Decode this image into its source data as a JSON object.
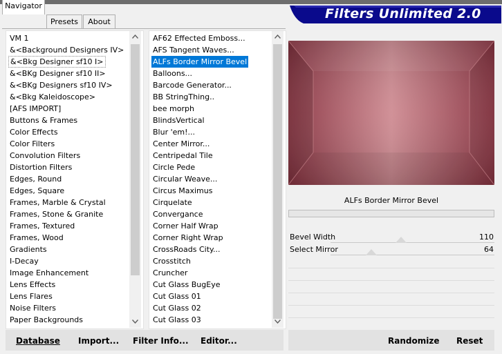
{
  "window": {
    "banner_title": "Filters Unlimited 2.0"
  },
  "tabs": [
    {
      "label": "Navigator",
      "active": true
    },
    {
      "label": "Presets",
      "active": false
    },
    {
      "label": "About",
      "active": false
    }
  ],
  "categories": {
    "items": [
      "VM 1",
      "&<Background Designers IV>",
      "&<Bkg Designer sf10 I>",
      "&<BKg Designer sf10 II>",
      "&<BKg Designers sf10 IV>",
      "&<Bkg Kaleidoscope>",
      "[AFS IMPORT]",
      "Buttons & Frames",
      "Color Effects",
      "Color Filters",
      "Convolution Filters",
      "Distortion Filters",
      "Edges, Round",
      "Edges, Square",
      "Frames, Marble & Crystal",
      "Frames, Stone & Granite",
      "Frames, Textured",
      "Frames, Wood",
      "Gradients",
      "I-Decay",
      "Image Enhancement",
      "Lens Effects",
      "Lens Flares",
      "Noise Filters",
      "Paper Backgrounds"
    ],
    "current": "&<Bkg Designer sf10 I>"
  },
  "filters": {
    "items": [
      "AF62 Effected Emboss...",
      "AFS Tangent Waves...",
      "ALFs Border Mirror Bevel",
      "Balloons...",
      "Barcode Generator...",
      "BB StringThing..",
      "bee morph",
      "BlindsVertical",
      "Blur 'em!...",
      "Center Mirror...",
      "Centripedal Tile",
      "Circle Pede",
      "Circular Weave...",
      "Circus Maximus",
      "Cirquelate",
      "Convergance",
      "Corner Half Wrap",
      "Corner Right Wrap",
      "CrossRoads City...",
      "Crosstitch",
      "Cruncher",
      "Cut Glass  BugEye",
      "Cut Glass 01",
      "Cut Glass 02",
      "Cut Glass 03"
    ],
    "selected": "ALFs Border Mirror Bevel"
  },
  "preview": {
    "colors": {
      "base": "#b15f67",
      "light": "#cf8c93",
      "dark": "#8a3442"
    }
  },
  "filter_name": "ALFs Border Mirror Bevel",
  "params": [
    {
      "label": "Bevel Width",
      "value": "110",
      "level": 0.431
    },
    {
      "label": "Select Mirror",
      "value": "64",
      "level": 0.251
    }
  ],
  "buttons": {
    "database": "Database",
    "import": "Import...",
    "filter_info": "Filter Info...",
    "editor": "Editor...",
    "randomize": "Randomize",
    "reset": "Reset"
  },
  "icons": {
    "scroll_up": "up-arrow-icon",
    "scroll_down": "down-arrow-icon"
  }
}
